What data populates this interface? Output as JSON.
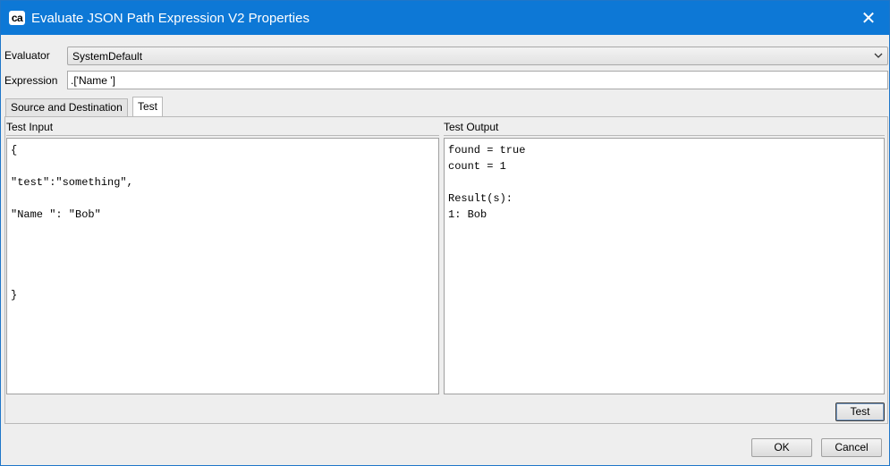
{
  "window": {
    "title": "Evaluate JSON Path Expression V2 Properties",
    "app_icon_text": "ca",
    "close_glyph": "✕"
  },
  "evaluator": {
    "label": "Evaluator",
    "selected": "SystemDefault"
  },
  "expression": {
    "label": "Expression",
    "value": ".['Name ']"
  },
  "tabs": [
    {
      "label": "Source and Destination",
      "active": false
    },
    {
      "label": "Test",
      "active": true
    }
  ],
  "test_input": {
    "label": "Test Input",
    "lines": [
      "{",
      "",
      "\"test\":\"something\",",
      "",
      "\"Name \": \"Bob\"",
      "",
      "",
      "",
      "",
      "}"
    ]
  },
  "test_output": {
    "label": "Test Output",
    "lines": [
      "found = true",
      "count = 1",
      "",
      "Result(s):",
      "1: Bob"
    ]
  },
  "buttons": {
    "test": "Test",
    "ok": "OK",
    "cancel": "Cancel"
  },
  "colors": {
    "titlebar": "#0d78d6",
    "window_bg": "#eeeeee"
  }
}
